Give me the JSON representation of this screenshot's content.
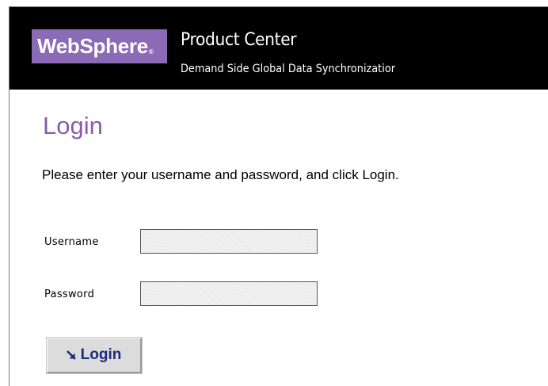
{
  "header": {
    "logo_text": "WebSphere",
    "logo_mark": "®",
    "product_title": "Product Center",
    "product_subtitle": "Demand Side Global Data Synchronizatior"
  },
  "login": {
    "heading": "Login",
    "instructions": "Please enter your username and password, and click Login.",
    "username_label": "Username",
    "username_value": "",
    "password_label": "Password",
    "password_value": "",
    "button_label": "Login",
    "button_icon": "arrow-down-right-icon"
  },
  "colors": {
    "banner_background": "#000000",
    "logo_background": "#8b6bb5",
    "heading_color": "#8a5ca8",
    "button_text": "#1d2b7a",
    "button_background": "#dcdcdc"
  }
}
